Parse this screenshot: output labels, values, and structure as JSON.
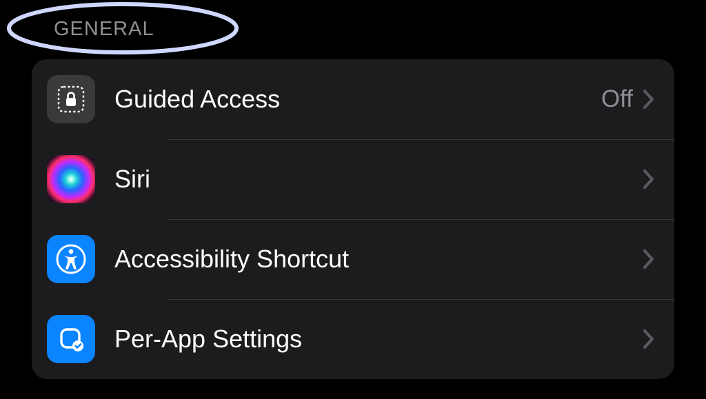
{
  "section": {
    "title": "GENERAL"
  },
  "rows": [
    {
      "label": "Guided Access",
      "value": "Off",
      "icon_name": "guided-access-icon"
    },
    {
      "label": "Siri",
      "value": "",
      "icon_name": "siri-icon"
    },
    {
      "label": "Accessibility Shortcut",
      "value": "",
      "icon_name": "accessibility-icon"
    },
    {
      "label": "Per-App Settings",
      "value": "",
      "icon_name": "per-app-settings-icon"
    }
  ],
  "colors": {
    "group_bg": "#1c1c1e",
    "accent": "#0a84ff",
    "secondary_text": "#8e8e93"
  }
}
